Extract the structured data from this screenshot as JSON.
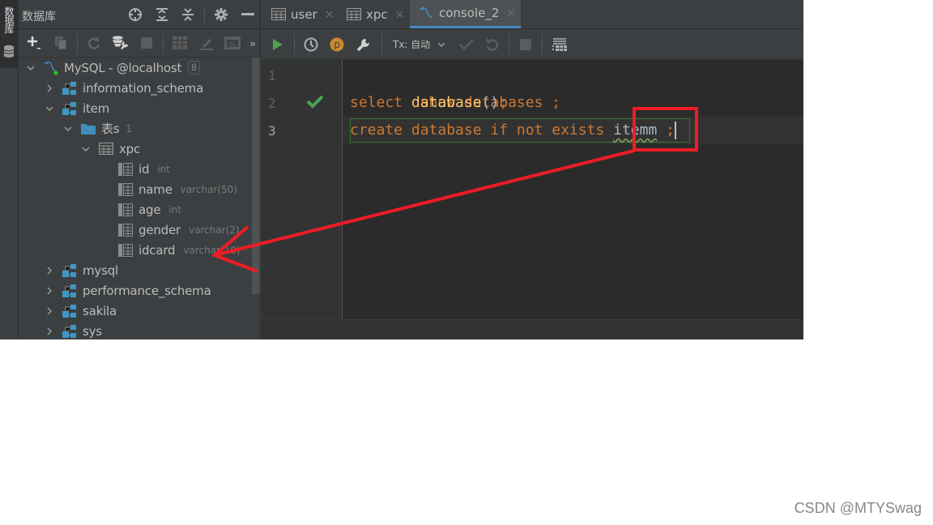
{
  "left_strip": {
    "label": "数据库",
    "icon": "database-stack-icon"
  },
  "db_panel": {
    "title": "数据库",
    "header_icons": [
      "locate-icon",
      "expand-all-icon",
      "collapse-all-icon",
      "settings-icon",
      "minimize-icon"
    ],
    "toolbar_icons": [
      "add-icon",
      "duplicate-icon",
      "refresh-icon",
      "data-source-properties-icon",
      "stop-icon",
      "table-view-icon",
      "edit-icon",
      "query-console-icon",
      "more-icon"
    ],
    "more_label": "»",
    "tree": {
      "connection": {
        "label": "MySQL - @localhost",
        "badge": "8"
      },
      "schemas": [
        {
          "label": "information_schema",
          "expanded": false
        },
        {
          "label": "item",
          "expanded": true,
          "folder": {
            "label": "表s",
            "count": "1"
          },
          "table": {
            "label": "xpc",
            "columns": [
              {
                "name": "id",
                "type": "int"
              },
              {
                "name": "name",
                "type": "varchar(50)"
              },
              {
                "name": "age",
                "type": "int"
              },
              {
                "name": "gender",
                "type": "varchar(2)"
              },
              {
                "name": "idcard",
                "type": "varchar(18)"
              }
            ]
          }
        },
        {
          "label": "mysql",
          "expanded": false
        },
        {
          "label": "performance_schema",
          "expanded": false
        },
        {
          "label": "sakila",
          "expanded": false
        },
        {
          "label": "sys",
          "expanded": false
        }
      ]
    }
  },
  "editor": {
    "tabs": [
      {
        "label": "user",
        "icon": "table-icon",
        "active": false
      },
      {
        "label": "xpc",
        "icon": "table-icon",
        "active": false
      },
      {
        "label": "console_2",
        "icon": "mysql-dolphin-icon",
        "active": true
      }
    ],
    "close_glyph": "×",
    "toolbar": {
      "tx_label": "Tx: 自动",
      "icons": [
        "execute-icon",
        "history-icon",
        "parameters-icon",
        "settings-wrench-icon",
        "commit-icon",
        "rollback-icon",
        "cancel-icon",
        "output-layout-icon"
      ],
      "param_glyph": "p"
    },
    "line_numbers": [
      "1",
      "2",
      "3"
    ],
    "code": {
      "line1": {
        "kw": "show databases ;"
      },
      "line2": {
        "kw": "select ",
        "fn": "database",
        "paren": "()",
        "end": ";"
      },
      "line3": {
        "kw": "create database if not exists ",
        "ident": "itemm",
        "end": " ;"
      }
    },
    "line2_status": "success-check-icon"
  },
  "annotation": {
    "color": "#ee1c25",
    "description": "Red box around 'itemm' with arrow pointing to the xpc table columns"
  },
  "watermark": "CSDN @MTYSwag"
}
